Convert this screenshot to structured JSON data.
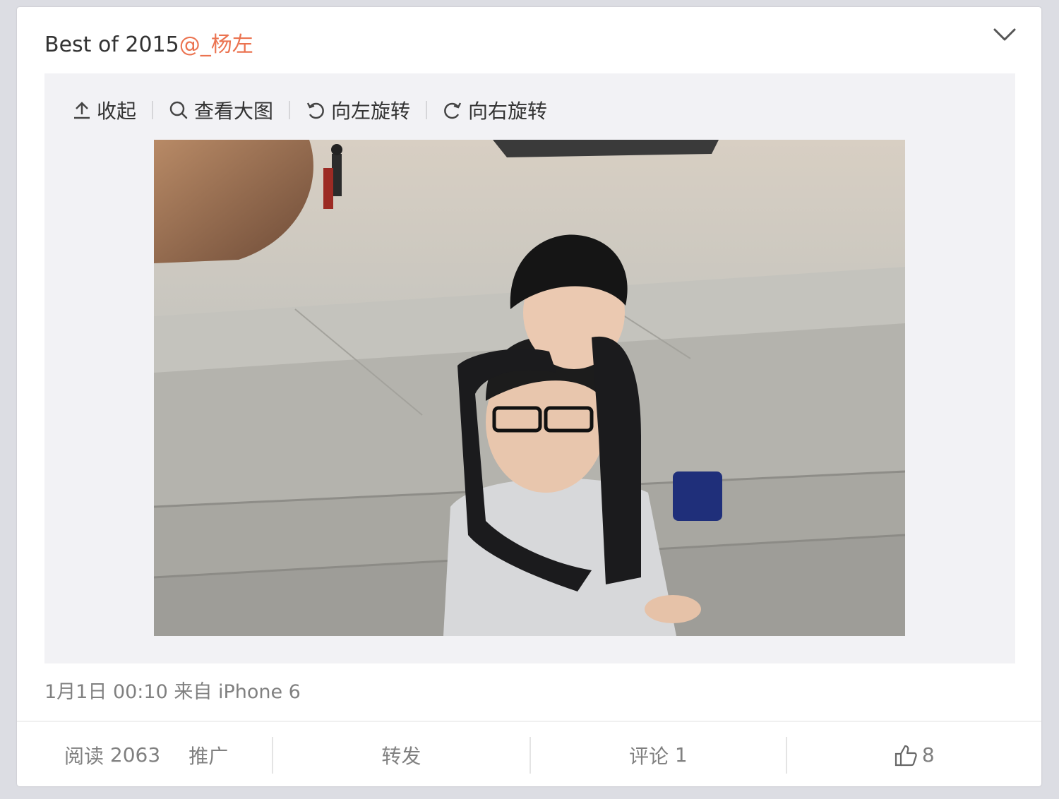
{
  "post": {
    "text": "Best of 2015",
    "mention": "@_杨左"
  },
  "toolbar": {
    "collapse": "收起",
    "view_large": "查看大图",
    "rotate_left": "向左旋转",
    "rotate_right": "向右旋转"
  },
  "meta": {
    "time": "1月1日 00:10",
    "source_prefix": "来自",
    "source": "iPhone 6"
  },
  "actions": {
    "reads_label": "阅读",
    "reads_count": "2063",
    "promote": "推广",
    "repost": "转发",
    "comment_label": "评论",
    "comment_count": "1",
    "likes": "8"
  },
  "colors": {
    "mention": "#eb7350",
    "text": "#333333",
    "muted": "#808080"
  },
  "icons": [
    "chevron-down-icon",
    "upload-arrow-icon",
    "magnifier-icon",
    "rotate-left-icon",
    "rotate-right-icon",
    "thumbs-up-icon"
  ]
}
